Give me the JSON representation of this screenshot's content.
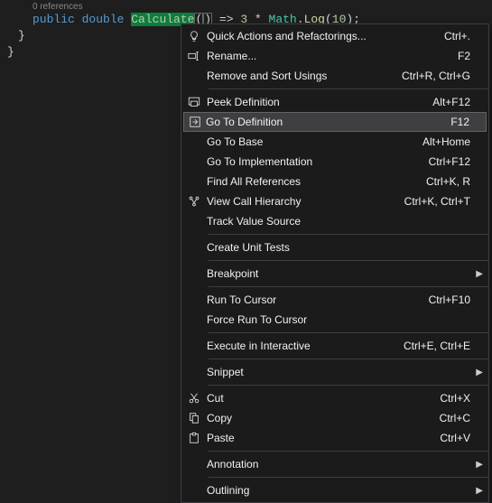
{
  "codelens": "0 references",
  "code": {
    "kw_public": "public",
    "kw_double": "double",
    "method": "Calculate",
    "lp": "(",
    "rp": ")",
    "arrow": " => ",
    "three": "3",
    "star": " * ",
    "math": "Math",
    "dot": ".",
    "log": "Log",
    "lp2": "(",
    "ten": "10",
    "rp2": ")",
    "semi": ";",
    "brace1": "}",
    "brace2": "}"
  },
  "menu": {
    "items": [
      {
        "label": "Quick Actions and Refactorings...",
        "shortcut": "Ctrl+.",
        "icon": "bulb"
      },
      {
        "label": "Rename...",
        "shortcut": "F2",
        "icon": "rename"
      },
      {
        "label": "Remove and Sort Usings",
        "shortcut": "Ctrl+R, Ctrl+G",
        "icon": ""
      },
      {
        "sep": true
      },
      {
        "label": "Peek Definition",
        "shortcut": "Alt+F12",
        "icon": "peek"
      },
      {
        "label": "Go To Definition",
        "shortcut": "F12",
        "icon": "goto",
        "highlight": true
      },
      {
        "label": "Go To Base",
        "shortcut": "Alt+Home",
        "icon": ""
      },
      {
        "label": "Go To Implementation",
        "shortcut": "Ctrl+F12",
        "icon": ""
      },
      {
        "label": "Find All References",
        "shortcut": "Ctrl+K, R",
        "icon": ""
      },
      {
        "label": "View Call Hierarchy",
        "shortcut": "Ctrl+K, Ctrl+T",
        "icon": "hierarchy"
      },
      {
        "label": "Track Value Source",
        "shortcut": "",
        "icon": ""
      },
      {
        "sep": true
      },
      {
        "label": "Create Unit Tests",
        "shortcut": "",
        "icon": ""
      },
      {
        "sep": true
      },
      {
        "label": "Breakpoint",
        "shortcut": "",
        "icon": "",
        "submenu": true
      },
      {
        "sep": true
      },
      {
        "label": "Run To Cursor",
        "shortcut": "Ctrl+F10",
        "icon": ""
      },
      {
        "label": "Force Run To Cursor",
        "shortcut": "",
        "icon": ""
      },
      {
        "sep": true
      },
      {
        "label": "Execute in Interactive",
        "shortcut": "Ctrl+E, Ctrl+E",
        "icon": ""
      },
      {
        "sep": true
      },
      {
        "label": "Snippet",
        "shortcut": "",
        "icon": "",
        "submenu": true
      },
      {
        "sep": true
      },
      {
        "label": "Cut",
        "shortcut": "Ctrl+X",
        "icon": "cut"
      },
      {
        "label": "Copy",
        "shortcut": "Ctrl+C",
        "icon": "copy"
      },
      {
        "label": "Paste",
        "shortcut": "Ctrl+V",
        "icon": "paste"
      },
      {
        "sep": true
      },
      {
        "label": "Annotation",
        "shortcut": "",
        "icon": "",
        "submenu": true
      },
      {
        "sep": true
      },
      {
        "label": "Outlining",
        "shortcut": "",
        "icon": "",
        "submenu": true
      }
    ]
  }
}
